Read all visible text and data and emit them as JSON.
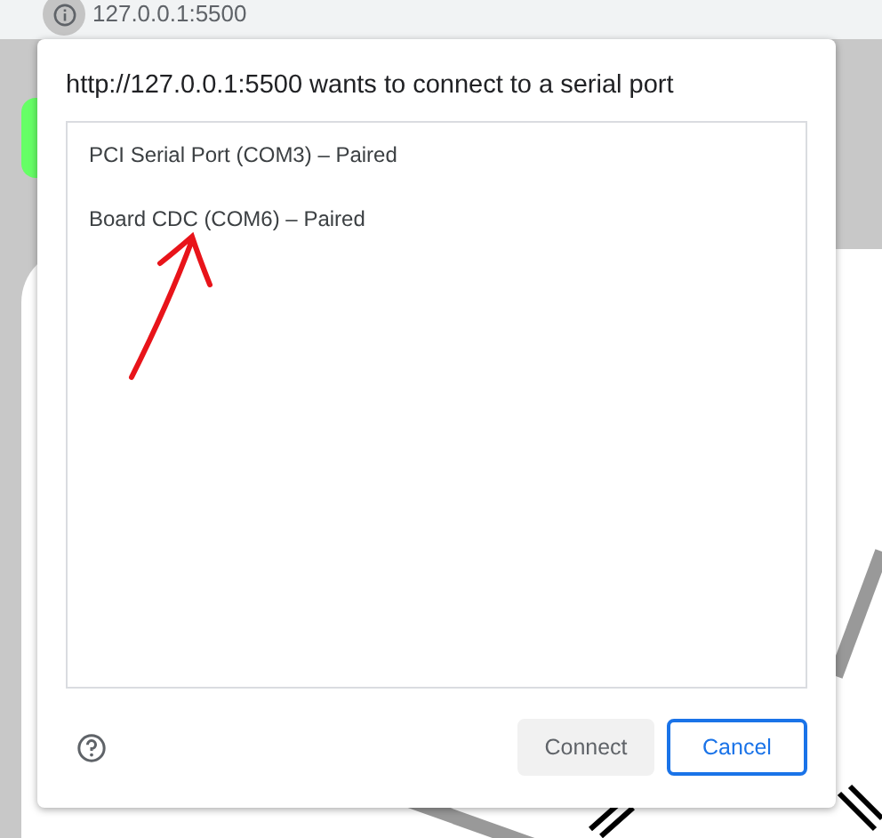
{
  "address_bar": {
    "url": "127.0.0.1:5500"
  },
  "dialog": {
    "title": "http://127.0.0.1:5500 wants to connect to a serial port",
    "ports": [
      {
        "label": "PCI Serial Port (COM3) – Paired",
        "selected": false
      },
      {
        "label": "Board CDC (COM6) – Paired",
        "selected": false
      }
    ],
    "connect_button": {
      "label": "Connect",
      "disabled": true
    },
    "cancel_button": {
      "label": "Cancel",
      "disabled": false
    }
  }
}
